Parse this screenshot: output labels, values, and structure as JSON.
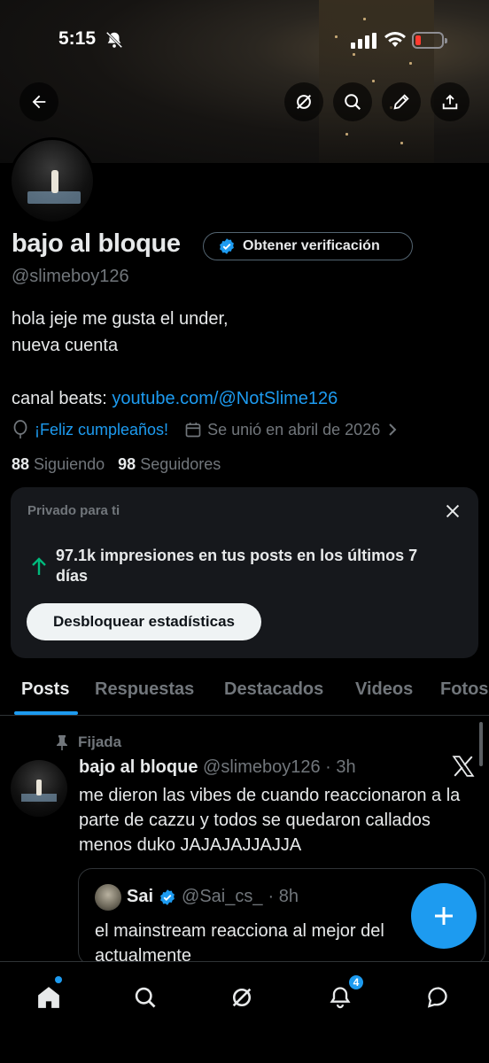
{
  "status_bar": {
    "time": "5:15"
  },
  "profile": {
    "name": "bajo al bloque",
    "verify_label": "Obtener verificación",
    "handle": "@slimeboy126",
    "bio_line1": "hola jeje me gusta el under,",
    "bio_line2": "nueva cuenta",
    "bio_prefix": "canal beats: ",
    "bio_link": "youtube.com/@NotSlime126",
    "birthday": "¡Feliz cumpleaños!",
    "joined": "Se unió en abril de 2026",
    "following_count": "88",
    "following_label": "Siguiendo",
    "followers_count": "98",
    "followers_label": "Seguidores"
  },
  "insights_card": {
    "heading": "Privado para ti",
    "stat": "97.1k impresiones en tus posts en los últimos 7 días",
    "button": "Desbloquear estadísticas"
  },
  "tabs": [
    "Posts",
    "Respuestas",
    "Destacados",
    "Videos",
    "Fotos"
  ],
  "post": {
    "pinned_label": "Fijada",
    "author": "bajo al bloque",
    "handle": "@slimeboy126",
    "time": "· 3h",
    "text": "me dieron las vibes de cuando reaccionaron a la parte de cazzu y todos se quedaron callados menos duko JAJAJAJJAJJA",
    "quote": {
      "author": "Sai",
      "handle": "@Sai_cs_",
      "time": "· 8h",
      "text": "el mainstream reacciona al mejor del actualmente"
    }
  },
  "nav": {
    "notifications_badge": "4"
  },
  "colors": {
    "accent": "#1d9bf0",
    "background": "#000000",
    "muted": "#71767b",
    "stat_arrow": "#00ba7c"
  }
}
